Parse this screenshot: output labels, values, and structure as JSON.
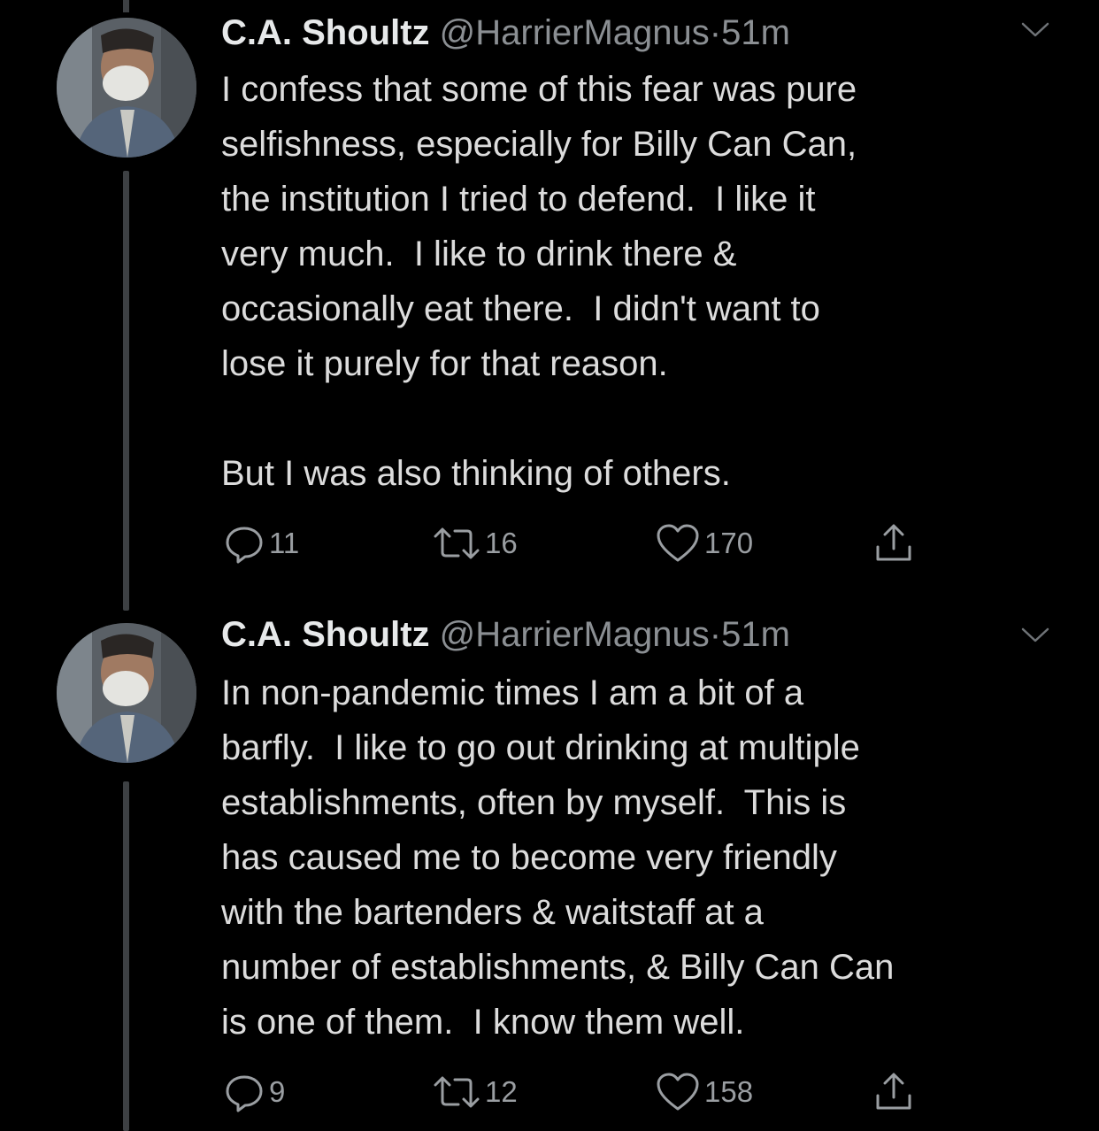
{
  "tweets": [
    {
      "name": "C.A. Shoultz",
      "handle": "@HarrierMagnus",
      "separator": "·",
      "time": "51m",
      "text": "I confess that some of this fear was pure\nselfishness, especially for Billy Can Can,\nthe institution I tried to defend.  I like it\nvery much.  I like to drink there &\noccasionally eat there.  I didn't want to\nlose it purely for that reason.\n\nBut I was also thinking of others.",
      "replies": "11",
      "retweets": "16",
      "likes": "170"
    },
    {
      "name": "C.A. Shoultz",
      "handle": "@HarrierMagnus",
      "separator": "·",
      "time": "51m",
      "text": "In non-pandemic times I am a bit of a\nbarfly.  I like to go out drinking at multiple\nestablishments, often by myself.  This is\nhas caused me to become very friendly\nwith the bartenders & waitstaff at a\nnumber of establishments, & Billy Can Can\nis one of them.  I know them well.",
      "replies": "9",
      "retweets": "12",
      "likes": "158"
    }
  ],
  "icons": {
    "reply": "reply-icon",
    "retweet": "retweet-icon",
    "like": "heart-icon",
    "share": "share-icon",
    "menu": "chevron-down-icon"
  },
  "colors": {
    "background": "#000000",
    "text": "#dcdcdc",
    "secondary": "#8b8f93",
    "thread_line": "#3d4043"
  }
}
